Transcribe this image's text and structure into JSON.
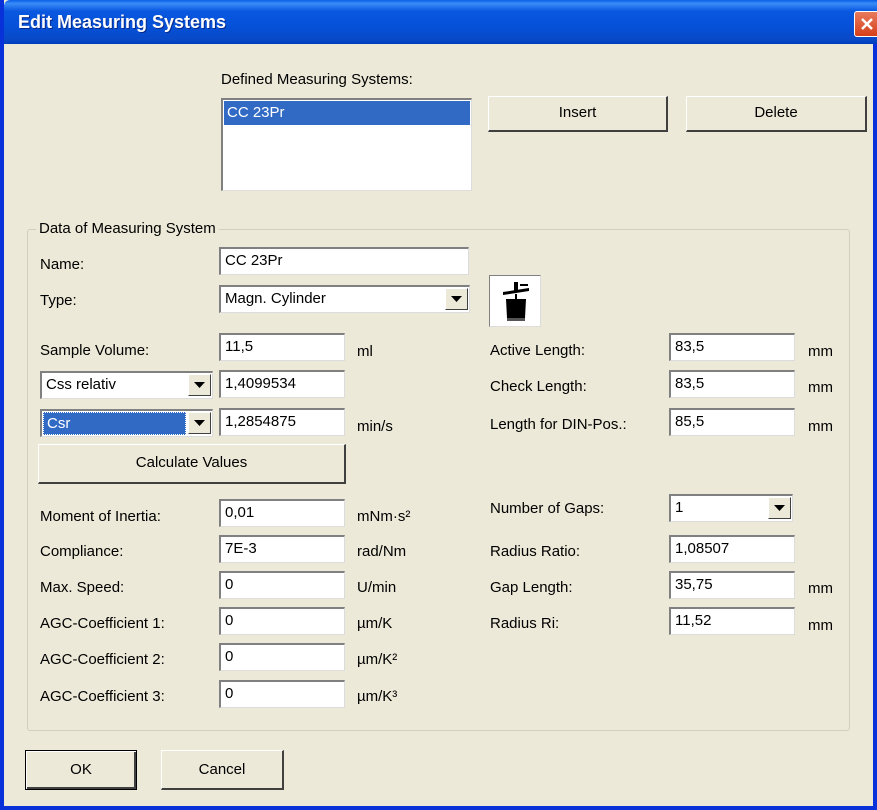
{
  "window": {
    "title": "Edit Measuring Systems"
  },
  "systems": {
    "label": "Defined Measuring Systems:",
    "items": [
      "CC 23Pr"
    ],
    "insert_label": "Insert",
    "delete_label": "Delete"
  },
  "group": {
    "title": "Data of Measuring System",
    "name_label": "Name:",
    "name_value": "CC 23Pr",
    "type_label": "Type:",
    "type_value": "Magn. Cylinder",
    "type_icon": "magnetic-cylinder-icon",
    "sample_volume": {
      "label": "Sample Volume:",
      "value": "11,5",
      "unit": "ml"
    },
    "css": {
      "selected": "Css relativ",
      "value": "1,4099534"
    },
    "csr": {
      "selected": "Csr",
      "value": "1,2854875",
      "unit": "min/s"
    },
    "calculate_label": "Calculate Values",
    "left_fields": [
      {
        "label": "Moment of Inertia:",
        "value": "0,01",
        "unit": "mNm·s²"
      },
      {
        "label": "Compliance:",
        "value": "7E-3",
        "unit": "rad/Nm"
      },
      {
        "label": "Max. Speed:",
        "value": "0",
        "unit": "U/min"
      },
      {
        "label": "AGC-Coefficient 1:",
        "value": "0",
        "unit": "µm/K"
      },
      {
        "label": "AGC-Coefficient 2:",
        "value": "0",
        "unit": "µm/K²"
      },
      {
        "label": "AGC-Coefficient 3:",
        "value": "0",
        "unit": "µm/K³"
      }
    ],
    "right_top_fields": [
      {
        "label": "Active Length:",
        "value": "83,5",
        "unit": "mm"
      },
      {
        "label": "Check Length:",
        "value": "83,5",
        "unit": "mm"
      },
      {
        "label": "Length for DIN-Pos.:",
        "value": "85,5",
        "unit": "mm"
      }
    ],
    "gaps": {
      "label": "Number of Gaps:",
      "value": "1"
    },
    "right_bottom_fields": [
      {
        "label": "Radius Ratio:",
        "value": "1,08507",
        "unit": ""
      },
      {
        "label": "Gap Length:",
        "value": "35,75",
        "unit": "mm"
      },
      {
        "label": "Radius Ri:",
        "value": "11,52",
        "unit": "mm"
      }
    ]
  },
  "footer": {
    "ok_label": "OK",
    "cancel_label": "Cancel"
  },
  "colors": {
    "titlebar": "#0551d8",
    "selection": "#316ac5",
    "dialog": "#ece9d8"
  }
}
